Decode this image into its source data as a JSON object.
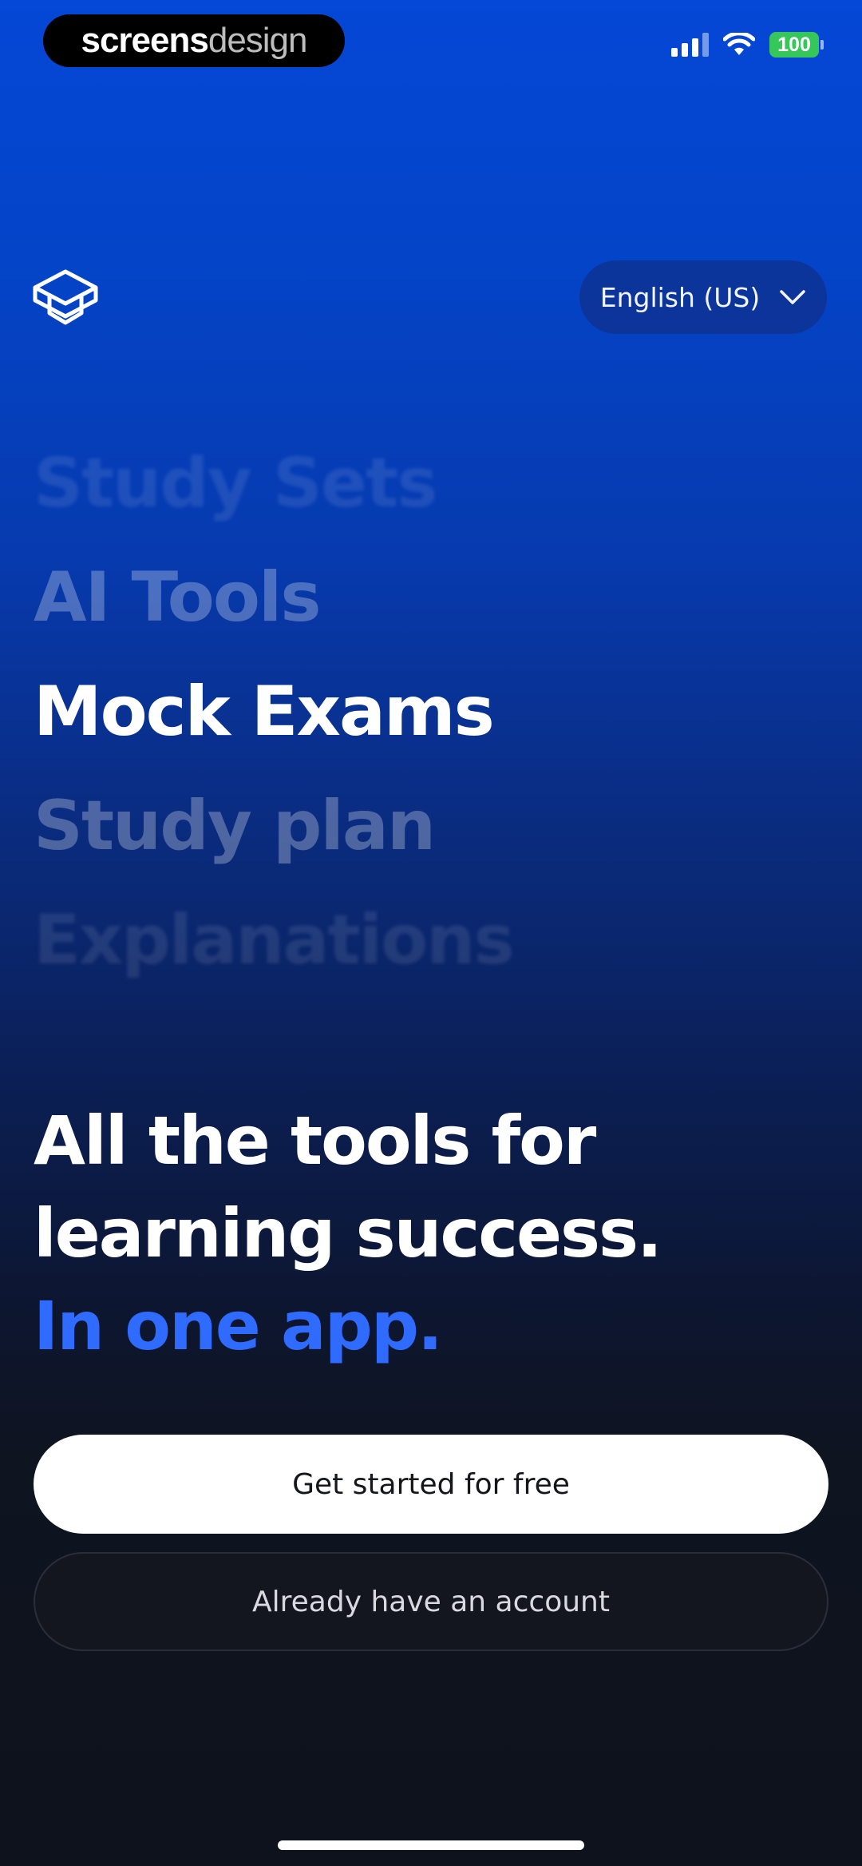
{
  "watermark": {
    "part1": "screens",
    "part2": "design"
  },
  "status_bar": {
    "battery_level": "100",
    "signal_icon": "cellular-signal-icon",
    "wifi_icon": "wifi-icon",
    "battery_color": "#35c759"
  },
  "header": {
    "logo_icon": "graduation-cap-icon",
    "language_label": "English (US)",
    "language_chevron_icon": "chevron-down-icon"
  },
  "features": [
    "Study Sets",
    "AI Tools",
    "Mock Exams",
    "Study plan",
    "Explanations"
  ],
  "headline": {
    "line1": "All the tools for",
    "line2": "learning success.",
    "line3": "In one app.",
    "accent_color": "#2f6bff"
  },
  "actions": {
    "primary_label": "Get started for free",
    "secondary_label": "Already have an account"
  }
}
